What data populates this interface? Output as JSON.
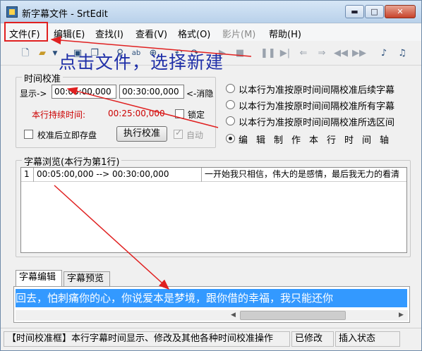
{
  "window": {
    "title": "新字幕文件 - SrtEdit",
    "min_glyph": "▬",
    "max_glyph": "□",
    "close_glyph": "✕"
  },
  "menu": [
    "文件(F)",
    "编辑(E)",
    "查找(I)",
    "查看(V)",
    "格式(O)",
    "影片(M)",
    "帮助(H)"
  ],
  "toolbar": {
    "icons": [
      "new-file-icon",
      "open-folder-icon",
      "dropdown-arrow-icon",
      "save-icon",
      "copy-icon",
      "find-icon",
      "spellcheck-icon",
      "zoom-icon",
      "undo-icon",
      "redo-icon",
      "play-icon",
      "stop-icon",
      "pause-icon",
      "step-forward-icon",
      "prev-icon",
      "next-icon",
      "rewind-icon",
      "fast-forward-icon",
      "effect1-icon",
      "effect2-icon"
    ],
    "annotation": "点击文件，选择新建"
  },
  "time_calibration": {
    "title": "时间校准",
    "display_label": "显示->",
    "start_time": "00:05:00,000",
    "end_time": "00:30:00,000",
    "end_label": "<-消隐",
    "duration_label": "本行持续时间:",
    "duration_value": "00:25:00,000",
    "lock_label": "锁定",
    "save_after_label": "校准后立即存盘",
    "run_button": "执行校准",
    "auto_label": "自动"
  },
  "calibration_options": [
    "以本行为准按原时间间隔校准后续字幕",
    "以本行为准按原时间间隔校准所有字幕",
    "以本行为准按原时间间隔校准所选区间",
    "编辑制作本行时间轴"
  ],
  "browse": {
    "title": "字幕浏览(本行为第1行)",
    "rows": [
      {
        "no": "1",
        "time": "00:05:00,000 --> 00:30:00,000",
        "text": "一开始我只相信，伟大的是感情，最后我无力的看清"
      }
    ]
  },
  "tabs": [
    "字幕编辑",
    "字幕预览"
  ],
  "edit_text": "回去，怕刺痛你的心，你说爱本是梦境，跟你借的幸福，我只能还你",
  "status": {
    "help": "【时间校准框】本行字幕时间显示、修改及其他各种时间校准操作",
    "modified": "已修改",
    "mode": "插入状态"
  }
}
